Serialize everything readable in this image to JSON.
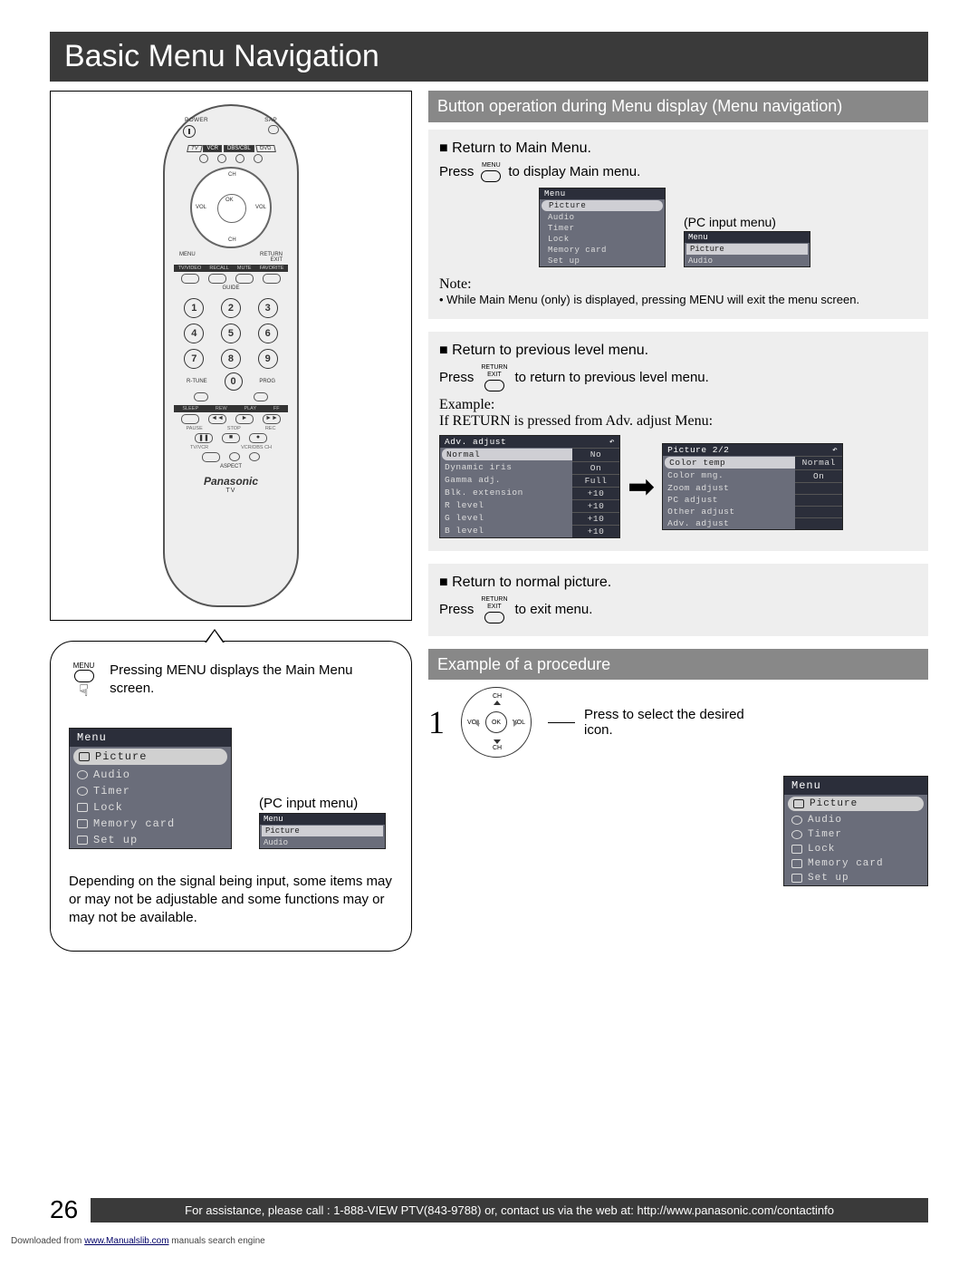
{
  "title": "Basic Menu Navigation",
  "remote": {
    "power": "POWER",
    "sap": "SAP",
    "modes": [
      "TV",
      "VCR",
      "DBS/CBL",
      "DVD"
    ],
    "pad": {
      "ch": "CH",
      "ok": "OK",
      "vol": "VOL"
    },
    "under_pad": [
      "MENU",
      "RETURN",
      "EXIT",
      "GUIDE"
    ],
    "row_btns": [
      "TV/VIDEO",
      "RECALL",
      "MUTE",
      "FAVORITE"
    ],
    "numbers": [
      "1",
      "2",
      "3",
      "4",
      "5",
      "6",
      "7",
      "8",
      "9",
      "0"
    ],
    "rtune": "R-TUNE",
    "prog": "PROG",
    "transport_row1": [
      "SLEEP",
      "REW",
      "PLAY",
      "FF"
    ],
    "transport_row2": [
      "PAUSE",
      "STOP",
      "REC"
    ],
    "bottom_row": [
      "TV/VCR",
      "VCR/DBS CH"
    ],
    "aspect": "ASPECT",
    "brand": "Panasonic",
    "tv": "TV"
  },
  "bubble": {
    "menu_btn_label": "MENU",
    "text1": "Pressing MENU displays the Main Menu screen.",
    "pc_label": "(PC input menu)",
    "note": "Depending on the signal being input, some items may or may not be adjustable and some functions may or may not be available."
  },
  "osd_menu": {
    "title": "Menu",
    "items": [
      "Picture",
      "Audio",
      "Timer",
      "Lock",
      "Memory card",
      "Set up"
    ]
  },
  "osd_pc": {
    "title": "Menu",
    "items": [
      "Picture",
      "Audio"
    ]
  },
  "right": {
    "sec1_title": "Button operation during Menu display (Menu navigation)",
    "block1": {
      "h": "Return to Main Menu.",
      "press": "Press",
      "btn": "MENU",
      "after": "to display Main menu.",
      "pc_label": "(PC input menu)",
      "note_label": "Note:",
      "note": "While Main Menu (only) is displayed, pressing MENU will exit the menu screen."
    },
    "block2": {
      "h": "Return to previous level menu.",
      "press": "Press",
      "btn_top": "RETURN",
      "btn_bot": "EXIT",
      "after": "to return to previous level menu.",
      "example": "Example:",
      "example2": "If RETURN is pressed from Adv. adjust Menu:"
    },
    "adv_adjust": {
      "title": "Adv. adjust",
      "rows": [
        [
          "Normal",
          "No"
        ],
        [
          "Dynamic iris",
          "On"
        ],
        [
          "Gamma adj.",
          "Full"
        ],
        [
          "Blk. extension",
          "+10"
        ],
        [
          "R level",
          "+10"
        ],
        [
          "G level",
          "+10"
        ],
        [
          "B level",
          "+10"
        ]
      ]
    },
    "picture22": {
      "title": "Picture 2/2",
      "rows": [
        [
          "Color temp",
          "Normal"
        ],
        [
          "Color mng.",
          "On"
        ],
        [
          "Zoom adjust",
          ""
        ],
        [
          "PC adjust",
          ""
        ],
        [
          "Other adjust",
          ""
        ],
        [
          "Adv. adjust",
          ""
        ]
      ]
    },
    "block3": {
      "h": "Return to normal picture.",
      "press": "Press",
      "btn_top": "RETURN",
      "btn_bot": "EXIT",
      "after": "to exit menu."
    },
    "sec2_title": "Example of a procedure",
    "step1": {
      "num": "1",
      "ch": "CH",
      "ok": "OK",
      "vol": "VOL",
      "text": "Press to select the desired icon."
    }
  },
  "footer": {
    "page": "26",
    "text": "For assistance, please call : 1-888-VIEW PTV(843-9788) or, contact us via the web at: http://www.panasonic.com/contactinfo",
    "dl_pre": "Downloaded from ",
    "dl_link": "www.Manualslib.com",
    "dl_post": " manuals search engine"
  }
}
